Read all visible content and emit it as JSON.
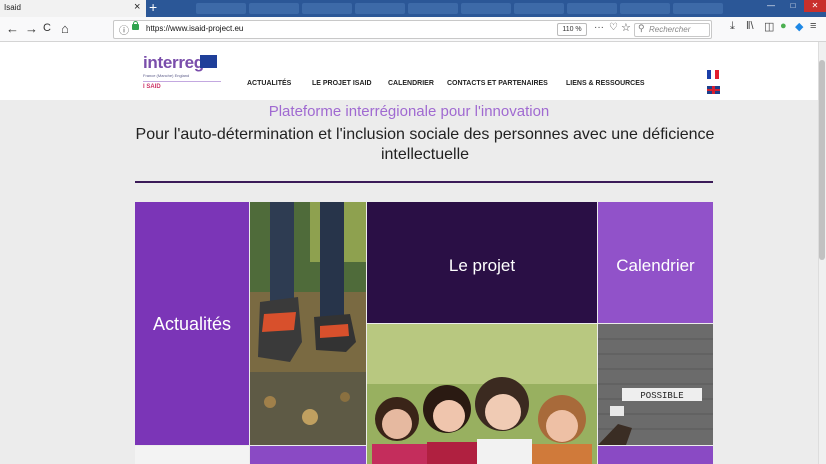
{
  "browser": {
    "tab_title": "Isaid",
    "tab_close": "×",
    "new_tab": "+",
    "nav_back": "←",
    "nav_forward": "→",
    "nav_reload": "C",
    "nav_home": "⌂",
    "url": "https://www.isaid-project.eu",
    "zoom": "110 %",
    "more": "···",
    "search_placeholder": "Rechercher",
    "win_min": "—",
    "win_max": "□",
    "win_close": "✕",
    "icons": [
      "info-icon",
      "lock-icon",
      "pocket-icon",
      "star-icon",
      "search-icon",
      "download-icon",
      "library-icon",
      "sidebar-icon",
      "menu-icon"
    ]
  },
  "site": {
    "logo_text": "interreg",
    "logo_sub": "France (Manche) England",
    "logo_project": "I SAID",
    "menu": [
      "ACTUALITÉS",
      "LE PROJET ISAID",
      "CALENDRIER",
      "CONTACTS ET PARTENAIRES",
      "LIENS & RESSOURCES"
    ],
    "subtitle": "Plateforme interrégionale pour l'innovation",
    "tagline": "Pour l'auto-détermination et l'inclusion sociale des personnes avec une déficience intellectuelle",
    "tiles": {
      "actualites": "Actualités",
      "projet": "Le projet",
      "calendrier": "Calendrier",
      "possible_text": "POSSIBLE"
    },
    "colors": {
      "purple": "#7b35b7",
      "dark_purple": "#2a0f45",
      "light_purple": "#9152c9",
      "subtitle": "#a06ad1"
    }
  }
}
